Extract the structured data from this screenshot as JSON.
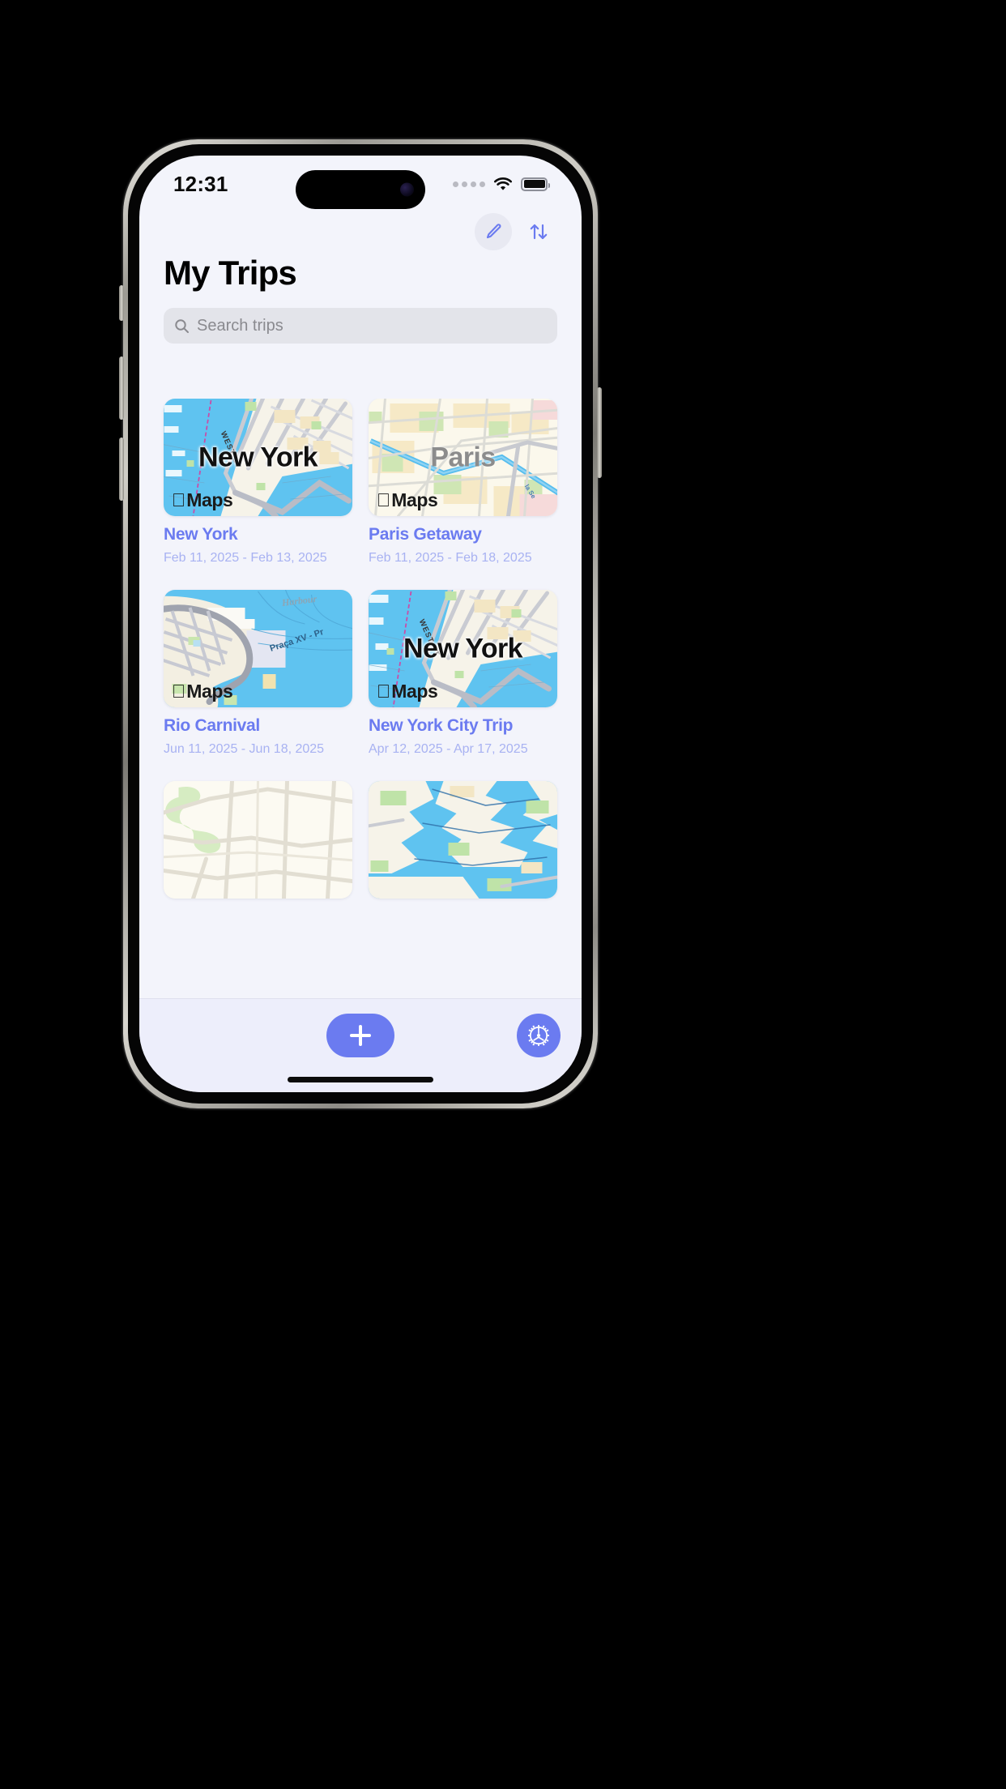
{
  "status_bar": {
    "time": "12:31",
    "signal_icon": "signal-dots-icon",
    "wifi_icon": "wifi-icon",
    "battery_icon": "battery-full-icon"
  },
  "nav_bar": {
    "edit_button": {
      "icon": "pencil-icon",
      "label": "Edit"
    },
    "sort_button": {
      "icon": "sort-arrows-icon",
      "label": "Sort"
    }
  },
  "header": {
    "title": "My Trips"
  },
  "search": {
    "placeholder": "Search trips",
    "value": "",
    "icon": "search-icon"
  },
  "trips": [
    {
      "title": "New York",
      "dates": "Feb 11, 2025 - Feb 13, 2025",
      "map_city_label": "New York",
      "map_street_label": "WEST ST",
      "map_watermark": "Maps",
      "label_style": "dark"
    },
    {
      "title": "Paris Getaway",
      "dates": "Feb 11, 2025 - Feb 18, 2025",
      "map_city_label": "Paris",
      "map_street_label": "la Se",
      "map_watermark": "Maps",
      "label_style": "grey"
    },
    {
      "title": "Rio Carnival",
      "dates": "Jun 11, 2025 - Jun 18, 2025",
      "map_city_label": "",
      "map_street_label": "Praça XV - Pr",
      "map_street_label_2": "Harbour",
      "map_watermark": "Maps",
      "label_style": "dark"
    },
    {
      "title": "New York City Trip",
      "dates": "Apr 12, 2025 - Apr 17, 2025",
      "map_city_label": "New York",
      "map_street_label": "WEST ST",
      "map_watermark": "Maps",
      "label_style": "dark"
    },
    {
      "title": "",
      "dates": "",
      "map_city_label": "",
      "map_street_label": "",
      "map_watermark": "",
      "label_style": "dark"
    },
    {
      "title": "",
      "dates": "",
      "map_city_label": "",
      "map_street_label": "",
      "map_watermark": "",
      "label_style": "dark"
    }
  ],
  "toolbar": {
    "add_button": {
      "icon": "plus-icon",
      "label": "Add Trip"
    },
    "settings_button": {
      "icon": "gear-icon",
      "label": "Settings"
    }
  },
  "colors": {
    "accent": "#6B7BF0",
    "date_text": "#A8B2F2",
    "screen_bg": "#F3F4FB",
    "toolbar_bg": "#EDEEFB",
    "search_bg": "#E3E4EA",
    "title_text": "#000000"
  }
}
